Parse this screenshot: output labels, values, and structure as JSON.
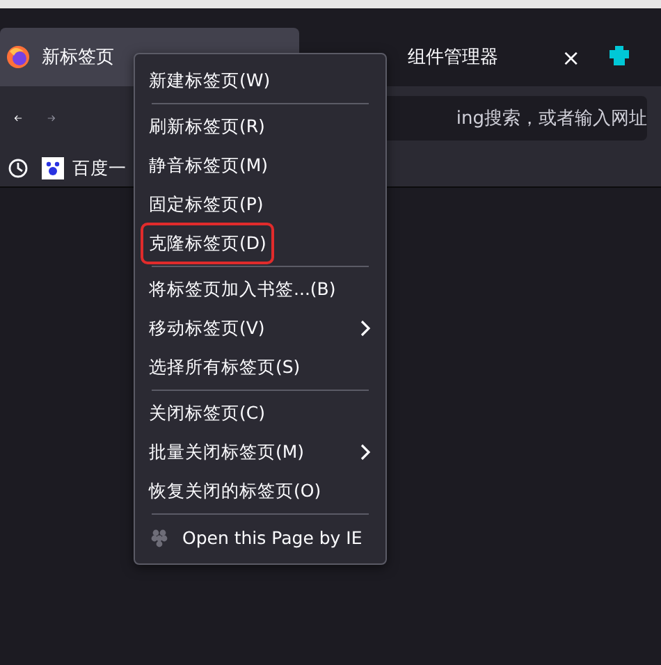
{
  "tabs": [
    {
      "label": "新标签页",
      "selected": true
    },
    {
      "label": "组件管理器",
      "selected": false,
      "close": "×"
    }
  ],
  "toolbar": {
    "address_placeholder": "ing搜索，或者输入网址"
  },
  "bookmarks": [
    {
      "label": "百度一"
    }
  ],
  "context_menu": [
    {
      "kind": "item",
      "label": "新建标签页(W)",
      "submenu": false,
      "highlighted": false
    },
    {
      "kind": "separator"
    },
    {
      "kind": "item",
      "label": "刷新标签页(R)",
      "submenu": false,
      "highlighted": false
    },
    {
      "kind": "item",
      "label": "静音标签页(M)",
      "submenu": false,
      "highlighted": false
    },
    {
      "kind": "item",
      "label": "固定标签页(P)",
      "submenu": false,
      "highlighted": false
    },
    {
      "kind": "item",
      "label": "克隆标签页(D)",
      "submenu": false,
      "highlighted": true
    },
    {
      "kind": "separator"
    },
    {
      "kind": "item",
      "label": "将标签页加入书签...(B)",
      "submenu": false,
      "highlighted": false
    },
    {
      "kind": "item",
      "label": "移动标签页(V)",
      "submenu": true,
      "highlighted": false
    },
    {
      "kind": "item",
      "label": "选择所有标签页(S)",
      "submenu": false,
      "highlighted": false
    },
    {
      "kind": "separator"
    },
    {
      "kind": "item",
      "label": "关闭标签页(C)",
      "submenu": false,
      "highlighted": false
    },
    {
      "kind": "item",
      "label": "批量关闭标签页(M)",
      "submenu": true,
      "highlighted": false
    },
    {
      "kind": "item",
      "label": "恢复关闭的标签页(O)",
      "submenu": false,
      "highlighted": false
    },
    {
      "kind": "separator"
    },
    {
      "kind": "extension",
      "label": "Open this Page by IE",
      "submenu": false,
      "highlighted": false
    }
  ]
}
